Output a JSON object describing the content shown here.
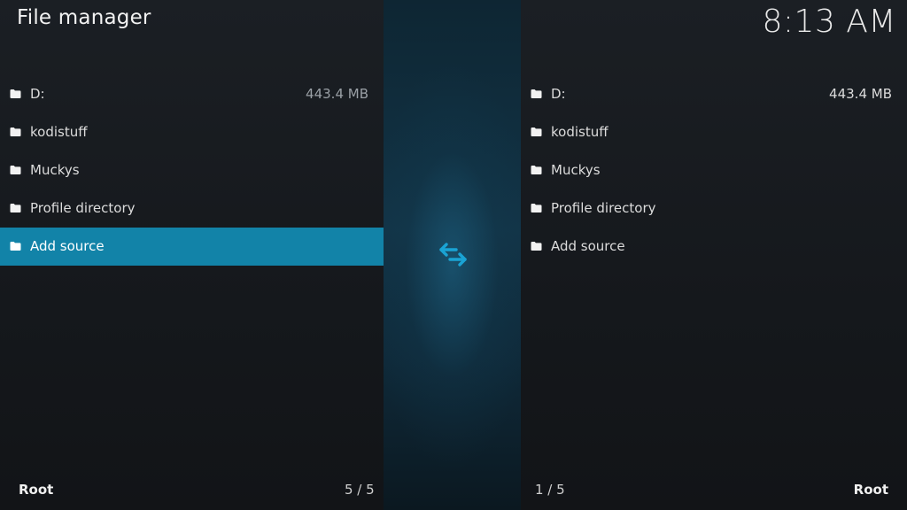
{
  "header": {
    "title": "File manager",
    "clock": "8:13 AM"
  },
  "colors": {
    "selection": "#1283a8",
    "accent": "#1aa3d4"
  },
  "left_pane": {
    "items": [
      {
        "label": "D:",
        "size": "443.4 MB",
        "icon": "folder-icon"
      },
      {
        "label": "kodistuff",
        "size": "",
        "icon": "folder-icon"
      },
      {
        "label": "Muckys",
        "size": "",
        "icon": "folder-icon"
      },
      {
        "label": "Profile directory",
        "size": "",
        "icon": "folder-icon"
      },
      {
        "label": "Add source",
        "size": "",
        "icon": "folder-icon",
        "selected": true
      }
    ],
    "path": "Root",
    "position": "5 / 5"
  },
  "right_pane": {
    "items": [
      {
        "label": "D:",
        "size": "443.4 MB",
        "icon": "folder-icon"
      },
      {
        "label": "kodistuff",
        "size": "",
        "icon": "folder-icon"
      },
      {
        "label": "Muckys",
        "size": "",
        "icon": "folder-icon"
      },
      {
        "label": "Profile directory",
        "size": "",
        "icon": "folder-icon"
      },
      {
        "label": "Add source",
        "size": "",
        "icon": "folder-icon"
      }
    ],
    "path": "Root",
    "position": "1 / 5"
  },
  "center": {
    "icon": "swap-arrows-icon"
  }
}
